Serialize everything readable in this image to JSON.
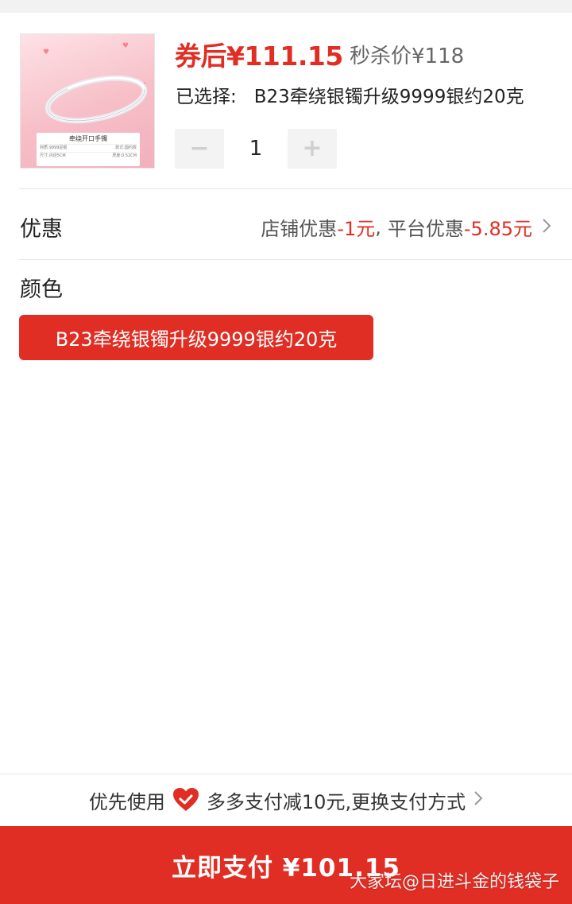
{
  "product": {
    "price_after_coupon": "券后¥111.15",
    "seckill_price": "秒杀价¥118",
    "selected_label": "已选择:",
    "selected_value": "B23牵绕银镯升级9999银约20克",
    "image_label": {
      "title": "牵绕开口手镯",
      "material_label": "材质:",
      "material_value": "9999足银",
      "style_label": "款式:",
      "style_value": "圆约款",
      "size_label": "尺寸:",
      "size_value": "内径5CM",
      "thickness_label": "厚度:",
      "thickness_value": "0.52CM"
    }
  },
  "quantity": {
    "minus_icon": "minus-icon",
    "plus_icon": "plus-icon",
    "value": "1"
  },
  "discount": {
    "label": "优惠",
    "shop_label": "店铺优惠",
    "shop_amount": "-1元",
    "separator": ",",
    "platform_label": "平台优惠",
    "platform_amount": "-5.85元",
    "chevron_icon": "chevron-right-icon"
  },
  "color": {
    "label": "颜色",
    "options": [
      {
        "label": "B23牵绕银镯升级9999银约20克",
        "selected": true
      }
    ]
  },
  "payment": {
    "prefix": "优先使用",
    "icon": "heart-check-icon",
    "method_text": "多多支付减10元,更换支付方式",
    "chevron_icon": "chevron-right-icon",
    "pay_button_label": "立即支付 ¥101.15"
  },
  "watermark": "大家坛@日进斗金的钱袋子",
  "colors": {
    "accent": "#e02e24",
    "muted": "#666666",
    "background": "#ffffff"
  }
}
